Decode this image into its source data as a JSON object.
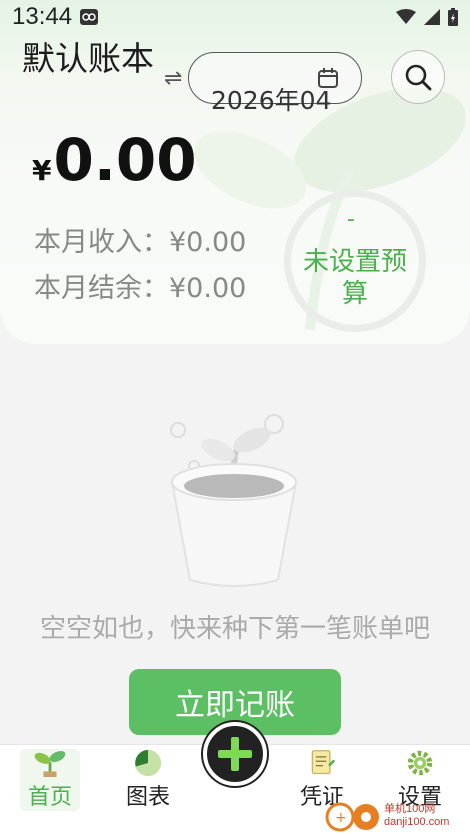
{
  "status_bar": {
    "time": "13:44"
  },
  "header": {
    "book_title": "默认账本",
    "swap_symbol": "⇌",
    "date": "2026年04",
    "currency_symbol": "¥",
    "balance": "0.00",
    "income_label": "本月收入：¥0.00",
    "balance_label": "本月结余：¥0.00",
    "budget_dash": "-",
    "budget_text": "未设置预算"
  },
  "main": {
    "empty_text": "空空如也，快来种下第一笔账单吧",
    "record_button": "立即记账"
  },
  "bottom_nav": {
    "items": [
      {
        "label": "首页",
        "icon": "sprout-icon",
        "active": true
      },
      {
        "label": "图表",
        "icon": "pie-chart-icon",
        "active": false
      },
      {
        "label": "凭证",
        "icon": "document-icon",
        "active": false
      },
      {
        "label": "设置",
        "icon": "gear-icon",
        "active": false
      }
    ],
    "add_icon": "plus-icon"
  },
  "watermark": {
    "line1": "单机100网",
    "line2": "danji100.com"
  },
  "colors": {
    "accent": "#5cbf63",
    "accent_text": "#4caf50",
    "header_bg": "#eef7ec"
  }
}
